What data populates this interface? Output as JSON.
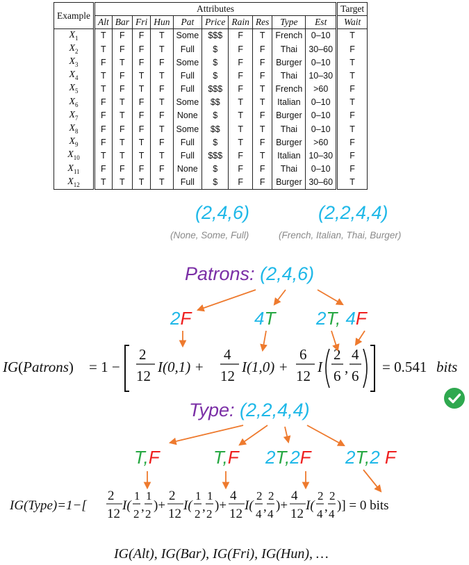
{
  "table": {
    "header_example": "Example",
    "header_attributes": "Attributes",
    "header_target": "Target",
    "columns": [
      "Alt",
      "Bar",
      "Fri",
      "Hun",
      "Pat",
      "Price",
      "Rain",
      "Res",
      "Type",
      "Est"
    ],
    "target_column": "Wait",
    "rows": [
      {
        "id": "X",
        "sub": "1",
        "cells": [
          "T",
          "F",
          "F",
          "T",
          "Some",
          "$$$",
          "F",
          "T",
          "French",
          "0–10"
        ],
        "wait": "T"
      },
      {
        "id": "X",
        "sub": "2",
        "cells": [
          "T",
          "F",
          "F",
          "T",
          "Full",
          "$",
          "F",
          "F",
          "Thai",
          "30–60"
        ],
        "wait": "F"
      },
      {
        "id": "X",
        "sub": "3",
        "cells": [
          "F",
          "T",
          "F",
          "F",
          "Some",
          "$",
          "F",
          "F",
          "Burger",
          "0–10"
        ],
        "wait": "T"
      },
      {
        "id": "X",
        "sub": "4",
        "cells": [
          "T",
          "F",
          "T",
          "T",
          "Full",
          "$",
          "F",
          "F",
          "Thai",
          "10–30"
        ],
        "wait": "T"
      },
      {
        "id": "X",
        "sub": "5",
        "cells": [
          "T",
          "F",
          "T",
          "F",
          "Full",
          "$$$",
          "F",
          "T",
          "French",
          ">60"
        ],
        "wait": "F"
      },
      {
        "id": "X",
        "sub": "6",
        "cells": [
          "F",
          "T",
          "F",
          "T",
          "Some",
          "$$",
          "T",
          "T",
          "Italian",
          "0–10"
        ],
        "wait": "T"
      },
      {
        "id": "X",
        "sub": "7",
        "cells": [
          "F",
          "T",
          "F",
          "F",
          "None",
          "$",
          "T",
          "F",
          "Burger",
          "0–10"
        ],
        "wait": "F"
      },
      {
        "id": "X",
        "sub": "8",
        "cells": [
          "F",
          "F",
          "F",
          "T",
          "Some",
          "$$",
          "T",
          "T",
          "Thai",
          "0–10"
        ],
        "wait": "T"
      },
      {
        "id": "X",
        "sub": "9",
        "cells": [
          "F",
          "T",
          "T",
          "F",
          "Full",
          "$",
          "T",
          "F",
          "Burger",
          ">60"
        ],
        "wait": "F"
      },
      {
        "id": "X",
        "sub": "10",
        "cells": [
          "T",
          "T",
          "T",
          "T",
          "Full",
          "$$$",
          "F",
          "T",
          "Italian",
          "10–30"
        ],
        "wait": "F"
      },
      {
        "id": "X",
        "sub": "11",
        "cells": [
          "F",
          "F",
          "F",
          "F",
          "None",
          "$",
          "F",
          "F",
          "Thai",
          "0–10"
        ],
        "wait": "F"
      },
      {
        "id": "X",
        "sub": "12",
        "cells": [
          "T",
          "T",
          "T",
          "T",
          "Full",
          "$",
          "F",
          "F",
          "Burger",
          "30–60"
        ],
        "wait": "T"
      }
    ]
  },
  "counts": {
    "pat_tuple": "(2,4,6)",
    "pat_values": "(None, Some, Full)",
    "type_tuple": "(2,2,4,4)",
    "type_values": "(French, Italian, Thai, Burger)"
  },
  "patrons": {
    "title_label": "Patrons:",
    "title_tuple": "(2,4,6)",
    "b1": {
      "n": "2",
      "cls": "F"
    },
    "b2": {
      "n": "4",
      "cls": "T"
    },
    "b3": {
      "n1": "2",
      "c1": "T",
      "sep": ",",
      "n2": "4",
      "c2": "F"
    },
    "formula": {
      "lhs": "IG",
      "arg": "Patrons",
      "eq": "= 1 −",
      "t1n": "2",
      "t1d": "12",
      "t1f": "I(0,1) +",
      "t2n": "4",
      "t2d": "12",
      "t2f": "I(1,0) +",
      "t3n": "6",
      "t3d": "12",
      "t3f": "I",
      "i1n": "2",
      "i1d": "6",
      "i2n": "4",
      "i2d": "6",
      "result": "= 0.541",
      "unit": "bits"
    }
  },
  "type": {
    "title_label": "Type:",
    "title_tuple": "(2,2,4,4)",
    "b1": {
      "c1": "T",
      "sep": ",",
      "c2": "F"
    },
    "b2": {
      "c1": "T",
      "sep": ",",
      "c2": "F"
    },
    "b3": {
      "n1": "2",
      "c1": "T",
      "sep": ",",
      "n2": "2",
      "c2": "F"
    },
    "b4": {
      "n1": "2",
      "c1": "T",
      "sep": ",",
      "n2": "2 ",
      "c2": "F"
    },
    "formula": {
      "lhs": "IG(Type)=1−[",
      "fracs": [
        {
          "wn": "2",
          "wd": "12",
          "an": "1",
          "ad": "2",
          "bn": "1",
          "bd": "2"
        },
        {
          "wn": "2",
          "wd": "12",
          "an": "1",
          "ad": "2",
          "bn": "1",
          "bd": "2"
        },
        {
          "wn": "4",
          "wd": "12",
          "an": "2",
          "ad": "4",
          "bn": "2",
          "bd": "4"
        },
        {
          "wn": "4",
          "wd": "12",
          "an": "2",
          "ad": "4",
          "bn": "2",
          "bd": "4"
        }
      ],
      "result": ")] = 0 bits"
    }
  },
  "footer": "IG(Alt), IG(Bar), IG(Fri), IG(Hun), …",
  "colors": {
    "cyan": "#1fb8e8",
    "green": "#27a843",
    "red": "#ef1f1f",
    "purple": "#7b2fa6",
    "arrow": "#ee7a2e",
    "check": "#2fa84f"
  },
  "icons": {
    "check": "check-circle-icon"
  }
}
